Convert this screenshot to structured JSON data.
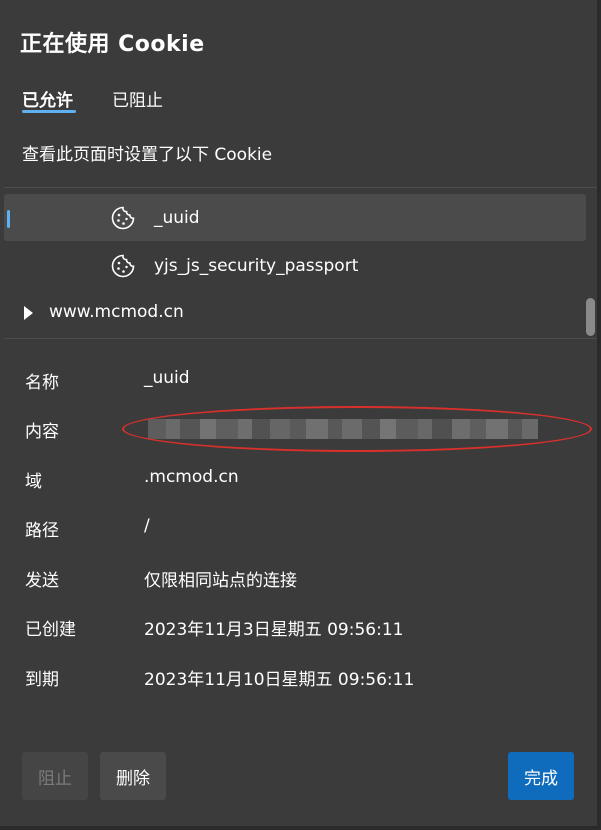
{
  "dialog": {
    "title": "正在使用 Cookie",
    "tabs": [
      {
        "label": "已允许",
        "active": true
      },
      {
        "label": "已阻止",
        "active": false
      }
    ],
    "description": "查看此页面时设置了以下 Cookie"
  },
  "tree": {
    "cookies": [
      {
        "name": "_uuid",
        "selected": true,
        "icon": "cookie-icon"
      },
      {
        "name": "yjs_js_security_passport",
        "selected": false,
        "icon": "cookie-icon"
      }
    ],
    "site": {
      "name": "www.mcmod.cn",
      "expanded": false,
      "icon": "caret-right-icon"
    }
  },
  "details": {
    "rows": [
      {
        "key": "名称",
        "value": "_uuid"
      },
      {
        "key": "内容",
        "value": ""
      },
      {
        "key": "域",
        "value": ".mcmod.cn"
      },
      {
        "key": "路径",
        "value": "/"
      },
      {
        "key": "发送",
        "value": "仅限相同站点的连接"
      },
      {
        "key": "已创建",
        "value": "2023年11月3日星期五 09:56:11"
      },
      {
        "key": "到期",
        "value": "2023年11月10日星期五 09:56:11"
      }
    ]
  },
  "buttons": {
    "block": "阻止",
    "delete": "删除",
    "done": "完成"
  },
  "colors": {
    "background": "#3b3b3b",
    "accent": "#5fb2f2",
    "primary_button": "#0f6cbd",
    "annotation": "#d9302c"
  }
}
